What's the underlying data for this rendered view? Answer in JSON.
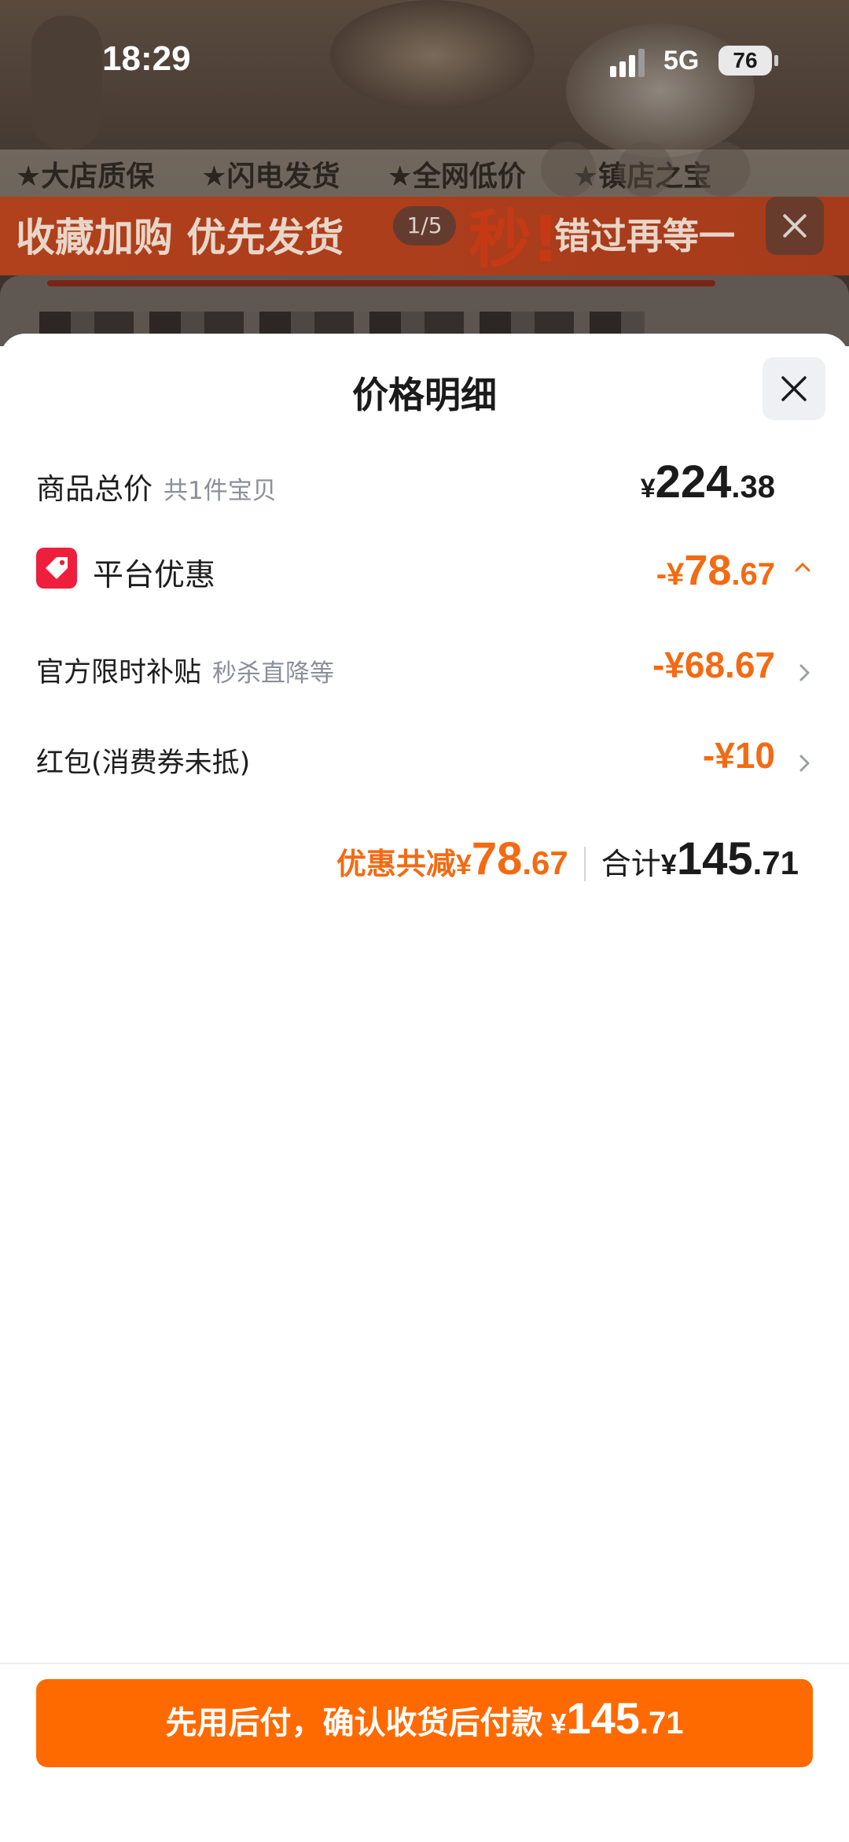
{
  "status_bar": {
    "time": "18:29",
    "network": "5G",
    "battery": "76"
  },
  "background": {
    "tags": [
      "★大店质保",
      "★闪电发货",
      "★全网低价",
      "★镇店之宝"
    ],
    "banner_left": "收藏加购 优先发货",
    "banner_miao": "秒!",
    "banner_right": "错过再等一",
    "pager": "1/5"
  },
  "sheet": {
    "title": "价格明细",
    "rows": {
      "total": {
        "label": "商品总价",
        "sub": "共1件宝贝",
        "yen": "¥",
        "int": "224",
        "dec": ".38"
      },
      "platform": {
        "label": "平台优惠",
        "prefix": "-¥",
        "int": "78",
        "dec": ".67"
      },
      "subsidy": {
        "label": "官方限时补贴",
        "sub": "秒杀直降等",
        "value": "-¥68.67"
      },
      "redpacket": {
        "label": "红包(消费券未抵)",
        "value": "-¥10"
      }
    },
    "summary": {
      "discount_label": "优惠共减",
      "discount_yen": "¥",
      "discount_int": "78",
      "discount_dec": ".67",
      "total_label": "合计",
      "total_yen": "¥",
      "total_int": "145",
      "total_dec": ".71"
    },
    "pay_button": {
      "label": "先用后付，确认收货后付款",
      "yen": "¥",
      "int": "145",
      "dec": ".71"
    }
  },
  "colors": {
    "accent_orange": "#f26b14",
    "button_orange": "#ff6a00",
    "tag_red": "#ee1f3d"
  },
  "icons": [
    "close-icon",
    "tag-icon",
    "chevron-up-icon",
    "chevron-right-icon"
  ]
}
